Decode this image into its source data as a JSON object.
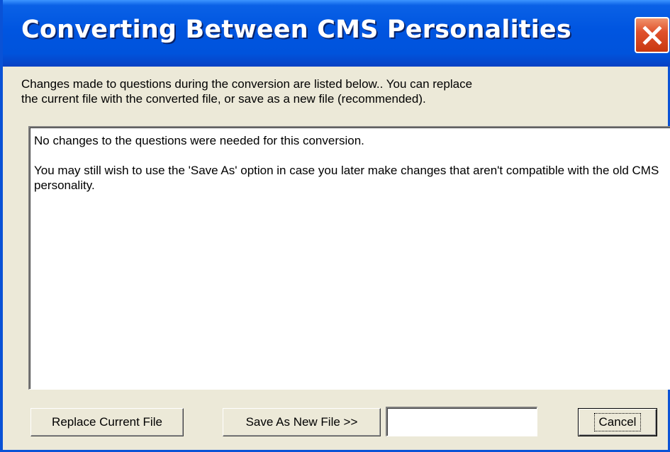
{
  "window": {
    "title": "Converting Between CMS Personalities",
    "title_color": "#FFFFFF",
    "titlebar_color": "#0055E0",
    "close_button_color": "#E0522C"
  },
  "instructions": "Changes made to questions during the conversion are listed below..  You can replace\nthe current file with the converted file, or save as a new file (recommended).",
  "messages": [
    "No changes to the questions were needed for this conversion.",
    "You may still wish to use the 'Save As' option in case you later make changes that aren't compatible with the old CMS personality."
  ],
  "buttons": {
    "replace": "Replace Current File",
    "save_as": "Save As New File >>",
    "cancel": "Cancel"
  },
  "filename_field": {
    "value": "",
    "placeholder": ""
  },
  "icons": {
    "close": "close-icon"
  }
}
